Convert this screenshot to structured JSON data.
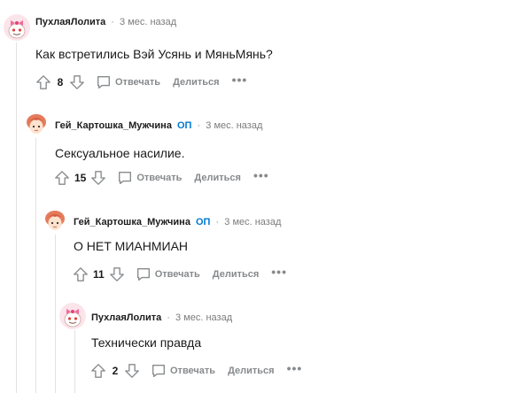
{
  "comments": [
    {
      "username": "ПухлаяЛолита",
      "op_badge": "",
      "time": "3 мес. назад",
      "text": "Как встретились Вэй Усянь и МяньМянь?",
      "score": "8",
      "reply_label": "Отвечать",
      "share_label": "Делиться",
      "more_label": "•••",
      "avatar_icon": "snoo-avatar-pink-bow"
    },
    {
      "username": "Гей_Картошка_Мужчина",
      "op_badge": "ОП",
      "time": "3 мес. назад",
      "text": "Сексуальное насилие.",
      "score": "15",
      "reply_label": "Отвечать",
      "share_label": "Делиться",
      "more_label": "•••",
      "avatar_icon": "red-haired-avatar"
    },
    {
      "username": "Гей_Картошка_Мужчина",
      "op_badge": "ОП",
      "time": "3 мес. назад",
      "text": "О НЕТ МИАНМИАН",
      "score": "11",
      "reply_label": "Отвечать",
      "share_label": "Делиться",
      "more_label": "•••",
      "avatar_icon": "red-haired-avatar"
    },
    {
      "username": "ПухлаяЛолита",
      "op_badge": "",
      "time": "3 мес. назад",
      "text": "Технически правда",
      "score": "2",
      "reply_label": "Отвечать",
      "share_label": "Делиться",
      "more_label": "•••",
      "avatar_icon": "snoo-avatar-pink-bow"
    }
  ],
  "meta_separator": "·",
  "colors": {
    "op_accent": "#0079d3",
    "muted_text": "#878a8c",
    "thread_line": "#e2e2e2"
  }
}
